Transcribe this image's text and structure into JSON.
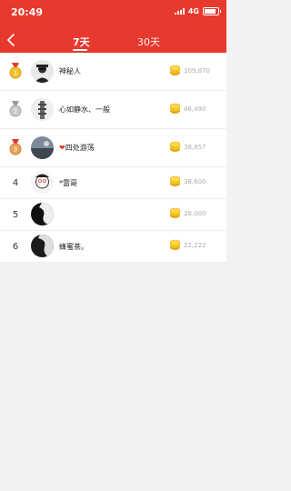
{
  "status_bar": {
    "time": "20:49",
    "network": "4G"
  },
  "header": {
    "tabs": [
      {
        "label": "7天",
        "active": true
      },
      {
        "label": "30天",
        "active": false
      }
    ]
  },
  "colors": {
    "brand_red": "#e8392e",
    "gold": "#f2c12e",
    "silver": "#c9c9c9",
    "bronze": "#e9a35a"
  },
  "ranking": [
    {
      "rank": "1",
      "medal": "gold",
      "name": "神秘人",
      "amount": "109,870"
    },
    {
      "rank": "2",
      "medal": "silver",
      "name": "心如静水、一般",
      "amount": "46,490"
    },
    {
      "rank": "3",
      "medal": "bronze",
      "name": "四处游荡",
      "heart": "❤",
      "amount": "38,857"
    },
    {
      "rank": "4",
      "medal": null,
      "name": "*雷哥",
      "amount": "38,600"
    },
    {
      "rank": "5",
      "medal": null,
      "name": "",
      "amount": "26,000"
    },
    {
      "rank": "6",
      "medal": null,
      "name": "蜂蜜茶。",
      "amount": "22,222"
    }
  ]
}
